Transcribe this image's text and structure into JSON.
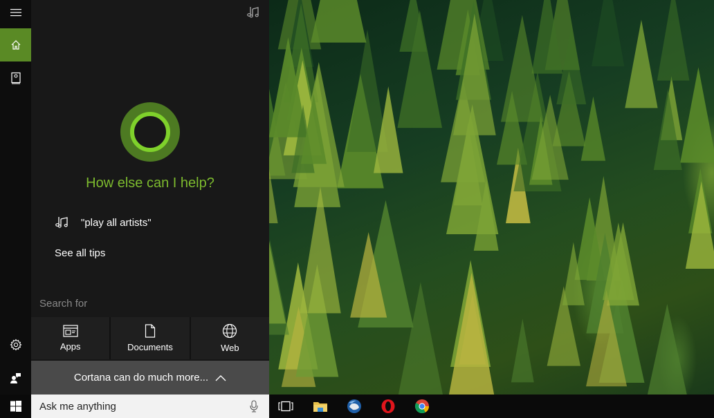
{
  "cortana": {
    "greeting": "How else can I help?",
    "tip_text": "\"play all artists\"",
    "see_all_tips": "See all tips",
    "search_for_label": "Search for",
    "search_tiles": [
      {
        "label": "Apps",
        "icon": "apps-icon"
      },
      {
        "label": "Documents",
        "icon": "document-icon"
      },
      {
        "label": "Web",
        "icon": "globe-icon"
      }
    ],
    "more_label": "Cortana can do much more...",
    "accent_color": "#5a8a25",
    "greeting_color": "#7dbb2e"
  },
  "rail": {
    "items": [
      "menu",
      "home",
      "notebook",
      "settings",
      "feedback"
    ]
  },
  "taskbar": {
    "search_placeholder": "Ask me anything",
    "apps": [
      "task-view",
      "file-explorer",
      "thunderbird",
      "opera",
      "chrome"
    ]
  }
}
